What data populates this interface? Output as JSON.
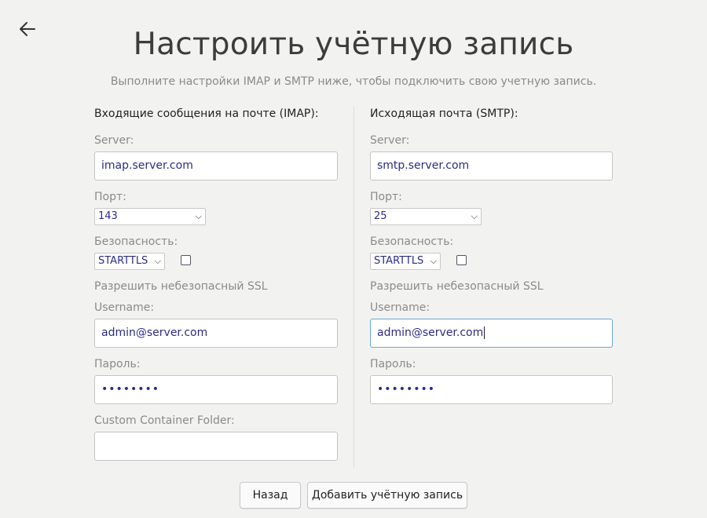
{
  "header": {
    "title": "Настроить учётную запись",
    "subtitle": "Выполните настройки IMAP и SMTP ниже, чтобы подключить свою учетную запись."
  },
  "imap": {
    "section_title": "Входящие сообщения на почте (IMAP):",
    "server_label": "Server:",
    "server_value": "imap.server.com",
    "port_label": "Порт:",
    "port_value": "143",
    "security_label": "Безопасность:",
    "security_value": "STARTTLS",
    "allow_insecure_label": "Разрешить небезопасный SSL",
    "allow_insecure_checked": false,
    "username_label": "Username:",
    "username_value": "admin@server.com",
    "password_label": "Пароль:",
    "password_value": "••••••••",
    "container_label": "Custom Container Folder:",
    "container_value": ""
  },
  "smtp": {
    "section_title": "Исходящая почта (SMTP):",
    "server_label": "Server:",
    "server_value": "smtp.server.com",
    "port_label": "Порт:",
    "port_value": "25",
    "security_label": "Безопасность:",
    "security_value": "STARTTLS",
    "allow_insecure_label": "Разрешить небезопасный SSL",
    "allow_insecure_checked": false,
    "username_label": "Username:",
    "username_value": "admin@server.com",
    "password_label": "Пароль:",
    "password_value": "••••••••"
  },
  "footer": {
    "back_label": "Назад",
    "add_label": "Добавить учётную запись"
  },
  "icons": {
    "back": "arrow-left-icon",
    "dropdown": "chevron-down-icon"
  },
  "colors": {
    "background": "#f2f3f1",
    "input_text": "#2b2c85",
    "focus_border": "#6aa6d6"
  }
}
